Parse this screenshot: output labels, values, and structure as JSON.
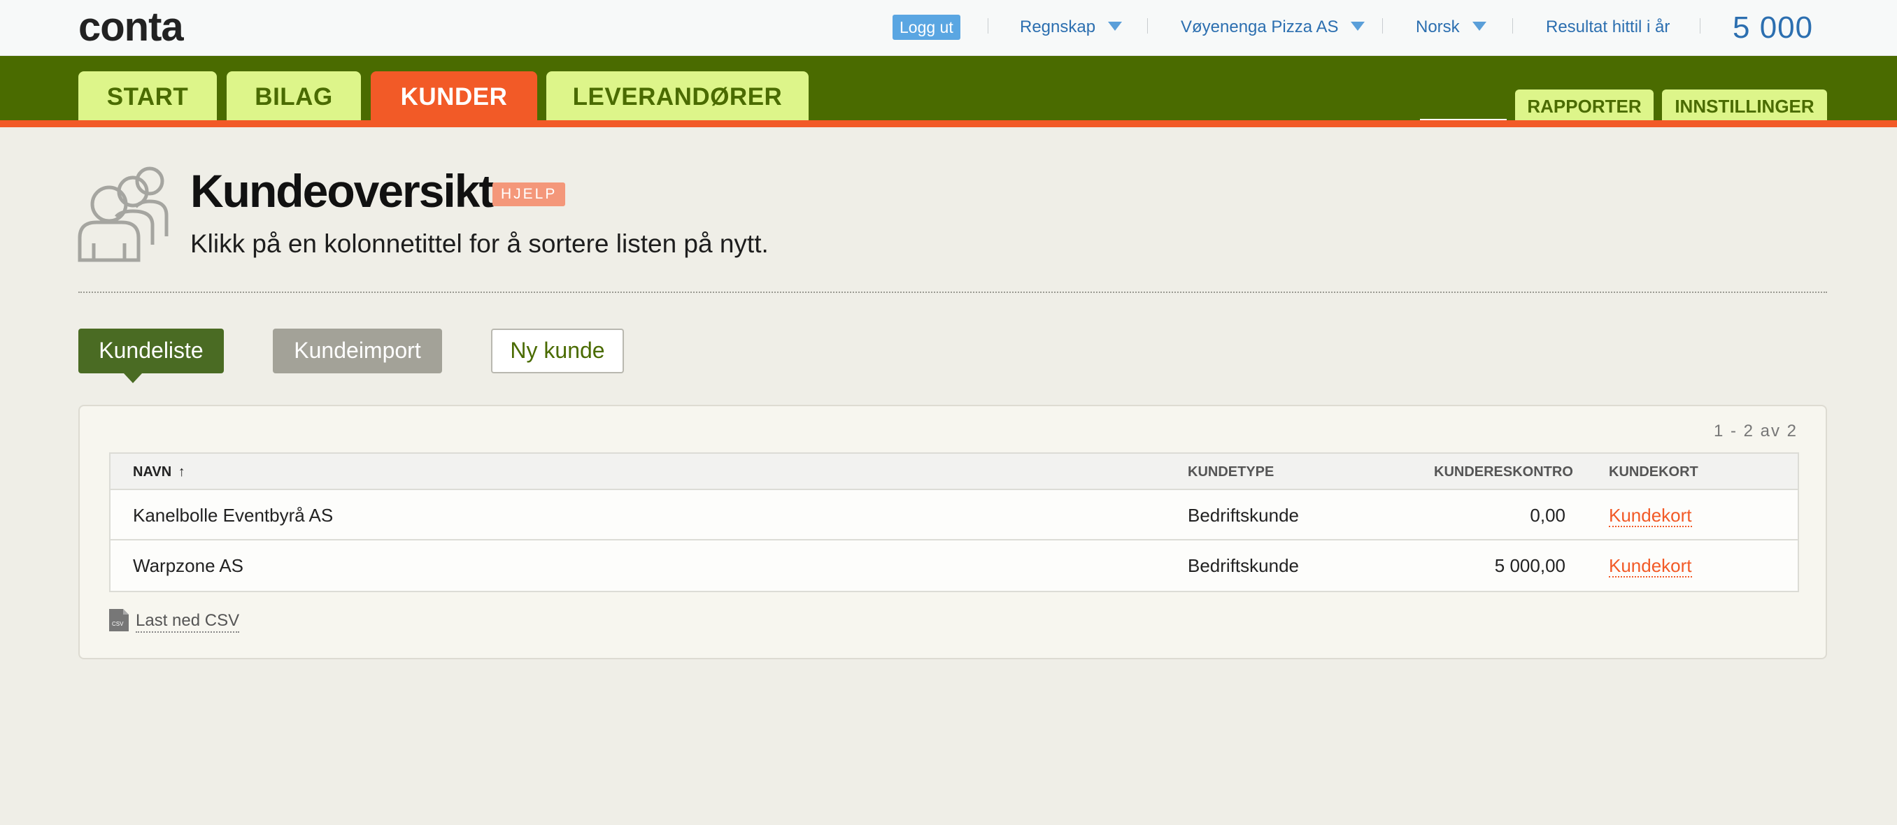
{
  "brand": {
    "logo_text": "conta"
  },
  "topbar": {
    "logout_label": "Logg ut",
    "accounting_label": "Regnskap",
    "company_label": "Vøyenenga Pizza AS",
    "language_label": "Norsk",
    "result_label": "Resultat hittil i år",
    "result_value": "5 000"
  },
  "nav": {
    "tabs": [
      {
        "label": "START"
      },
      {
        "label": "BILAG"
      },
      {
        "label": "KUNDER",
        "active": true
      },
      {
        "label": "LEVERANDØRER"
      }
    ],
    "secondary": [
      {
        "label": "RAPPORTER"
      },
      {
        "label": "INNSTILLINGER"
      }
    ]
  },
  "header": {
    "title": "Kundeoversikt",
    "help_label": "HJELP",
    "subtitle": "Klikk på en kolonnetittel for å sortere listen på nytt."
  },
  "actions": {
    "customer_list": "Kundeliste",
    "customer_import": "Kundeimport",
    "new_customer": "Ny kunde"
  },
  "table": {
    "pager": "1 - 2  av  2",
    "columns": {
      "name": "NAVN",
      "type": "KUNDETYPE",
      "ledger": "KUNDERESKONTRO",
      "card": "KUNDEKORT"
    },
    "sort_indicator": "↑",
    "rows": [
      {
        "name": "Kanelbolle Eventbyrå AS",
        "type": "Bedriftskunde",
        "ledger": "0,00",
        "card": "Kundekort"
      },
      {
        "name": "Warpzone AS",
        "type": "Bedriftskunde",
        "ledger": "5 000,00",
        "card": "Kundekort"
      }
    ]
  },
  "footer": {
    "csv_icon_label": "CSV",
    "csv_link": "Last ned CSV"
  },
  "colors": {
    "nav_green": "#4a6b00",
    "tab_light": "#ddf58a",
    "accent_orange": "#f25a27",
    "link_blue": "#2c6fb0",
    "button_green": "#4a6b23"
  }
}
